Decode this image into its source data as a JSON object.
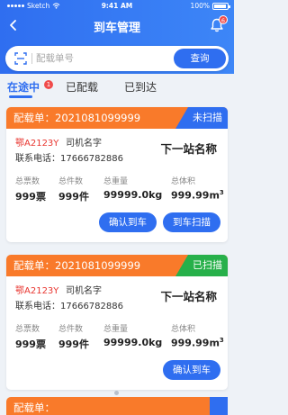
{
  "status_bar": {
    "carrier": "Sketch",
    "time": "9:41 AM",
    "battery": "100%"
  },
  "header": {
    "title": "到车管理",
    "notification_count": "6"
  },
  "search": {
    "placeholder": "配载单号",
    "button_label": "查询"
  },
  "tabs": [
    {
      "label": "在途中",
      "badge": "1",
      "active": true
    },
    {
      "label": "已配载",
      "active": false
    },
    {
      "label": "已到达",
      "active": false
    }
  ],
  "cards": [
    {
      "title": "配载单：2021081099999",
      "status": "未扫描",
      "plate": "鄂A2123Y",
      "driver": "司机名字",
      "phone": "联系电话：17666782886",
      "next_station": "下一站名称",
      "stats": [
        {
          "label": "总票数",
          "value": "999票"
        },
        {
          "label": "总件数",
          "value": "999件"
        },
        {
          "label": "总重量",
          "value": "99999.0kg"
        },
        {
          "label": "总体积",
          "value": "999.99m",
          "sup": "3"
        }
      ],
      "buttons": [
        "确认到车",
        "到车扫描"
      ]
    },
    {
      "title": "配载单：2021081099999",
      "status": "已扫描",
      "plate": "鄂A2123Y",
      "driver": "司机名字",
      "phone": "联系电话：17666782886",
      "next_station": "下一站名称",
      "stats": [
        {
          "label": "总票数",
          "value": "999票"
        },
        {
          "label": "总件数",
          "value": "999件"
        },
        {
          "label": "总重量",
          "value": "99999.0kg"
        },
        {
          "label": "总体积",
          "value": "999.99m",
          "sup": "3"
        }
      ],
      "buttons": [
        "确认到车"
      ]
    }
  ],
  "peek_card": {
    "title": "配载单："
  },
  "colors": {
    "primary": "#2f6ef0",
    "header_orange": "#f97a2a",
    "scanned_green": "#27b04a",
    "plate_red": "#e8352f"
  }
}
